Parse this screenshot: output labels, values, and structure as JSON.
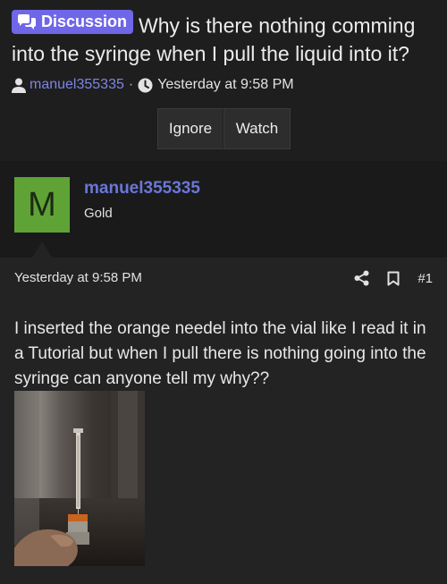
{
  "thread": {
    "badge": "Discussion",
    "title": "Why is there nothing comming into the syringe when I pull the liquid into it?",
    "author": "manuel355335",
    "separator": "·",
    "timestamp": "Yesterday at 9:58 PM"
  },
  "actions": {
    "ignore_label": "Ignore",
    "watch_label": "Watch"
  },
  "user": {
    "avatar_letter": "M",
    "avatar_color": "#5fa336",
    "username": "manuel355335",
    "rank": "Gold",
    "username_color": "#6a77d8"
  },
  "post": {
    "date": "Yesterday at 9:58 PM",
    "post_number": "#1",
    "body": "I inserted the orange needel into the vial like I read it in a Tutorial but when I pull there is nothing going into the syringe can anyone tell my why??",
    "icons": [
      "share-icon",
      "bookmark-icon"
    ]
  },
  "colors": {
    "badge_bg": "#6f66e8",
    "accent_link": "#7b86e0",
    "page_bg": "#1e1e1f"
  }
}
